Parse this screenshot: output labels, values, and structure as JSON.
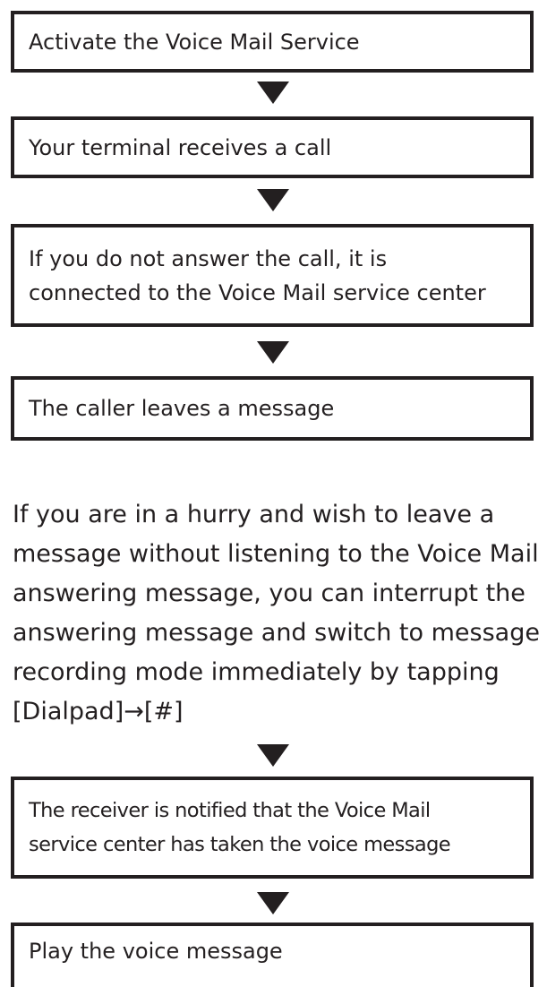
{
  "flow": {
    "step1": "Activate the Voice Mail Service",
    "step2": "Your terminal receives a call",
    "step3": {
      "line1": "If you do not answer the call, it is",
      "line2": "connected to the Voice Mail service center"
    },
    "step4": "The caller leaves a message",
    "note": {
      "line1": "If you are in a hurry and wish to leave a",
      "line2": "message without listening to the Voice Mail",
      "line3": "answering message, you can interrupt the",
      "line4": "answering message and switch to message",
      "line5": "recording mode immediately by tapping",
      "line6": "[Dialpad]→[#]"
    },
    "step5": {
      "line1": "The receiver is notified that the Voice Mail",
      "line2": "service center has taken the voice message"
    },
    "step6": "Play the voice message"
  }
}
